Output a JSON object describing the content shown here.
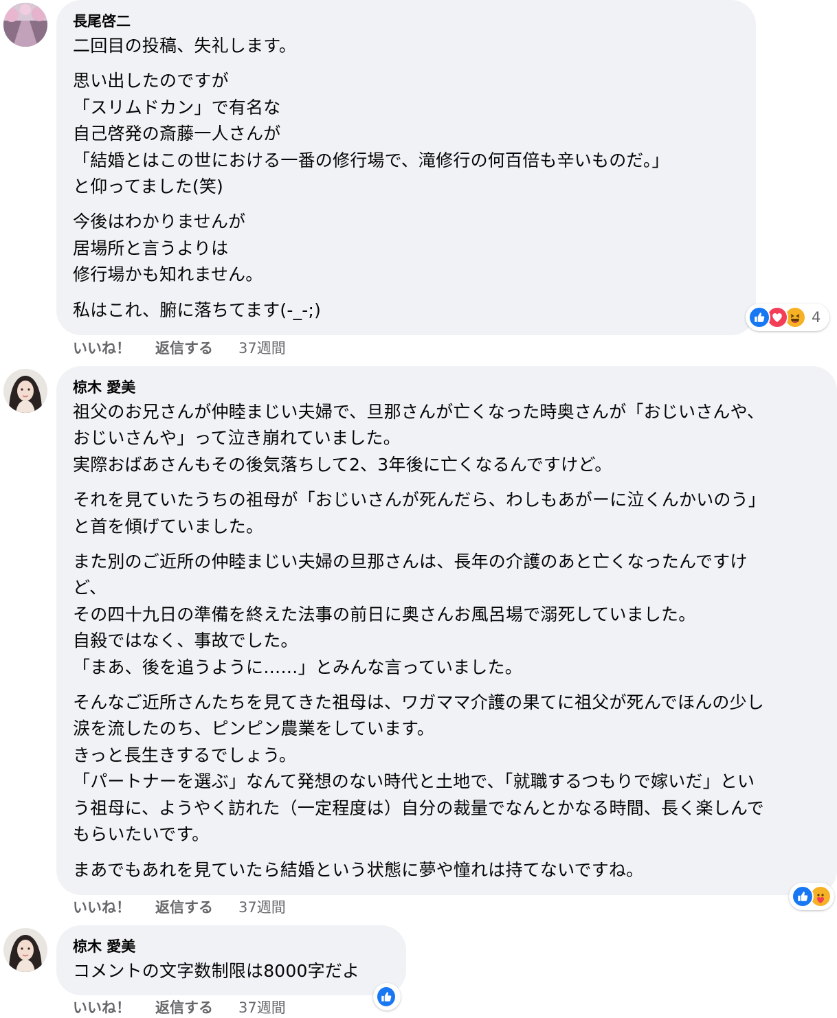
{
  "comments": [
    {
      "author": "長尾啓二",
      "paragraphs": [
        "二回目の投稿、失礼します。",
        "思い出したのですが\n「スリムドカン」で有名な\n自己啓発の斎藤一人さんが\n「結婚とはこの世における一番の修行場で、滝修行の何百倍も辛いものだ。」\nと仰ってました(笑)",
        "今後はわかりませんが\n居場所と言うよりは\n修行場かも知れません。",
        "私はこれ、腑に落ちてます(-_-;)"
      ],
      "like_label": "いいね！",
      "reply_label": "返信する",
      "time": "37週間",
      "reactions": {
        "icons": [
          "like-icon",
          "love-icon",
          "haha-icon"
        ],
        "count": "4"
      }
    },
    {
      "author": "椋木 愛美",
      "paragraphs": [
        "祖父のお兄さんが仲睦まじい夫婦で、旦那さんが亡くなった時奥さんが「おじいさんや、\nおじいさんや」って泣き崩れていました。\n実際おばあさんもその後気落ちして2、3年後に亡くなるんですけど。",
        "それを見ていたうちの祖母が「おじいさんが死んだら、わしもあがーに泣くんかいのう」\nと首を傾げていました。",
        "また別のご近所の仲睦まじい夫婦の旦那さんは、長年の介護のあと亡くなったんですけ\nど、\nその四十九日の準備を終えた法事の前日に奥さんお風呂場で溺死していました。\n自殺ではなく、事故でした。\n「まあ、後を追うように……」とみんな言っていました。",
        "そんなご近所さんたちを見てきた祖母は、ワガママ介護の果てに祖父が死んでほんの少し\n涙を流したのち、ピンピン農業をしています。\nきっと長生きするでしょう。\n「パートナーを選ぶ」なんて発想のない時代と土地で、「就職するつもりで嫁いだ」とい\nう祖母に、ようやく訪れた（一定程度は）自分の裁量でなんとかなる時間、長く楽しんで\nもらいたいです。",
        "まあでもあれを見ていたら結婚という状態に夢や憧れは持てないですね。"
      ],
      "like_label": "いいね！",
      "reply_label": "返信する",
      "time": "37週間",
      "reactions": {
        "icons": [
          "like-icon",
          "care-icon"
        ],
        "count": ""
      }
    },
    {
      "author": "椋木 愛美",
      "paragraphs": [
        "コメントの文字数制限は8000字だよ"
      ],
      "like_label": "いいね！",
      "reply_label": "返信する",
      "time": "37週間",
      "reactions": {
        "icons": [
          "like-icon"
        ],
        "count": ""
      }
    }
  ],
  "colors": {
    "bubble": "#f0f2f5",
    "meta_text": "#65676b",
    "like_blue": "#1877f2",
    "love_red": "#f33e58",
    "haha_yellow": "#f7b125"
  }
}
